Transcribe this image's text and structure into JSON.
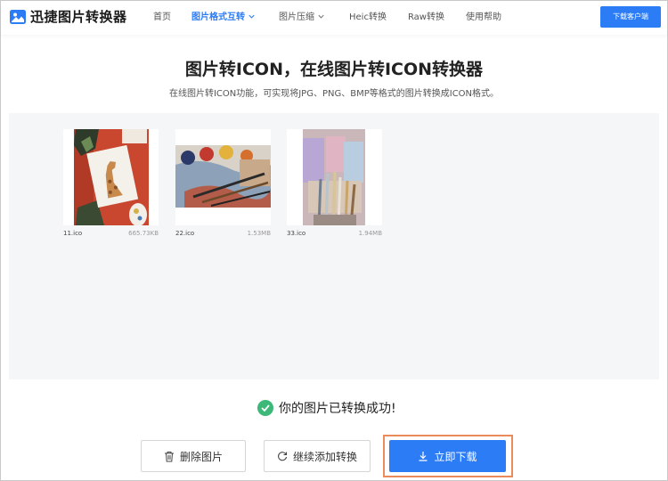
{
  "brand": {
    "name": "迅捷图片转换器",
    "logo_icon": "image-logo-icon"
  },
  "nav": {
    "items": [
      {
        "label": "首页",
        "active": false,
        "dropdown": false
      },
      {
        "label": "图片格式互转",
        "active": true,
        "dropdown": true
      },
      {
        "label": "图片压缩",
        "active": false,
        "dropdown": true
      },
      {
        "label": "Heic转换",
        "active": false,
        "dropdown": false
      },
      {
        "label": "Raw转换",
        "active": false,
        "dropdown": false
      },
      {
        "label": "使用帮助",
        "active": false,
        "dropdown": false
      }
    ],
    "download_client": "下载客户端"
  },
  "page": {
    "title": "图片转ICON，在线图片转ICON转换器",
    "subtitle": "在线图片转ICON功能，可实现将JPG、PNG、BMP等格式的图片转换成ICON格式。"
  },
  "files": [
    {
      "name": "11.ico",
      "size": "665.73KB",
      "thumbnail": "giraffe-card-photo"
    },
    {
      "name": "22.ico",
      "size": "1.53MB",
      "thumbnail": "paint-palette-photo"
    },
    {
      "name": "33.ico",
      "size": "1.94MB",
      "thumbnail": "brushes-photo"
    }
  ],
  "status": {
    "message": "你的图片已转换成功!"
  },
  "actions": {
    "delete": "删除图片",
    "continue": "继续添加转换",
    "download": "立即下载"
  },
  "colors": {
    "accent": "#2c7cf6",
    "success": "#3cb878",
    "highlight_outline": "#e98b5a"
  }
}
